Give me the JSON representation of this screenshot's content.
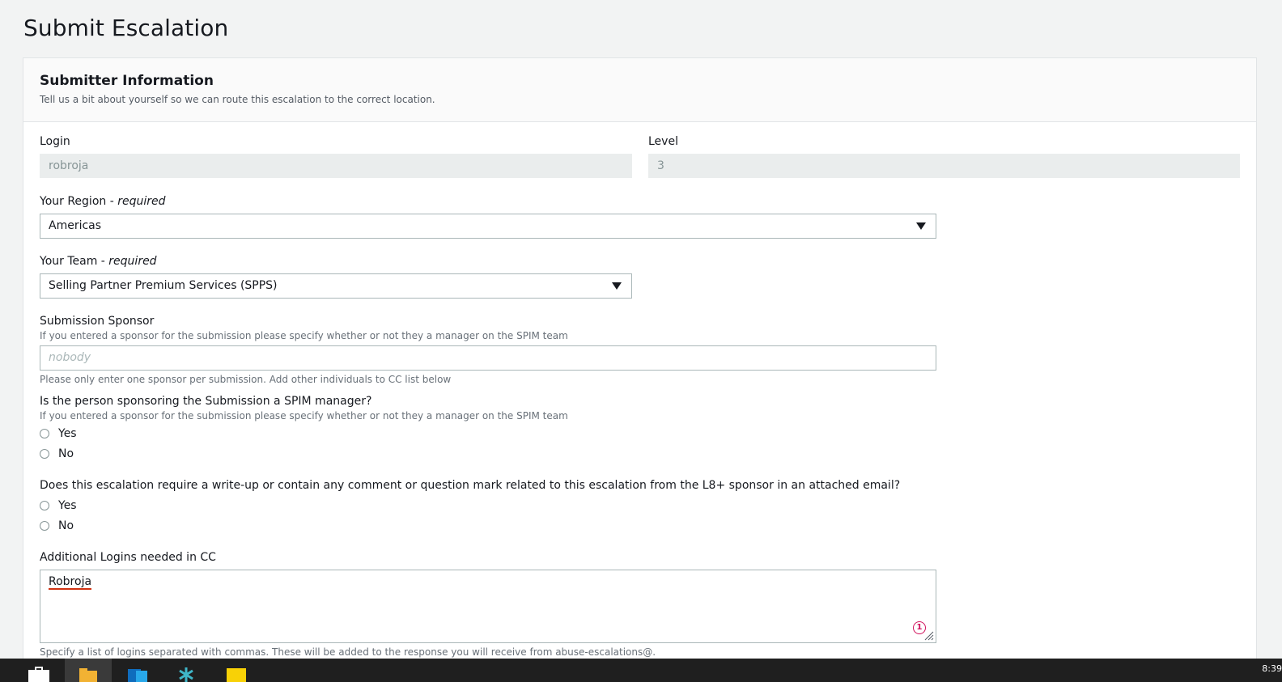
{
  "page": {
    "title": "Submit Escalation"
  },
  "section": {
    "title": "Submitter Information",
    "description": "Tell us a bit about yourself so we can route this escalation to the correct location."
  },
  "login": {
    "label": "Login",
    "value": "robroja"
  },
  "level": {
    "label": "Level",
    "value": "3"
  },
  "region": {
    "label": "Your Region - ",
    "required": "required",
    "value": "Americas"
  },
  "team": {
    "label": "Your Team - ",
    "required": "required",
    "value": "Selling Partner Premium Services (SPPS)"
  },
  "sponsor": {
    "label": "Submission Sponsor",
    "description": "If you entered a sponsor for the submission please specify whether or not they a manager on the SPIM team",
    "placeholder": "nobody",
    "help": "Please only enter one sponsor per submission. Add other individuals to CC list below"
  },
  "spim_manager": {
    "label": "Is the person sponsoring the Submission a SPIM manager?",
    "description": "If you entered a sponsor for the submission please specify whether or not they a manager on the SPIM team",
    "options": [
      "Yes",
      "No"
    ]
  },
  "writeup": {
    "label": "Does this escalation require a write-up or contain any comment or question mark related to this escalation from the L8+ sponsor in an attached email?",
    "options": [
      "Yes",
      "No"
    ]
  },
  "cc": {
    "label": "Additional Logins needed in CC",
    "value": "Robroja",
    "badge": "1",
    "help": "Specify a list of logins separated with commas. These will be added to the response you will receive from abuse-escalations@."
  },
  "taskbar": {
    "clock": "8:39"
  },
  "colors": {
    "accent_error": "#d13212",
    "badge": "#d0115c"
  }
}
